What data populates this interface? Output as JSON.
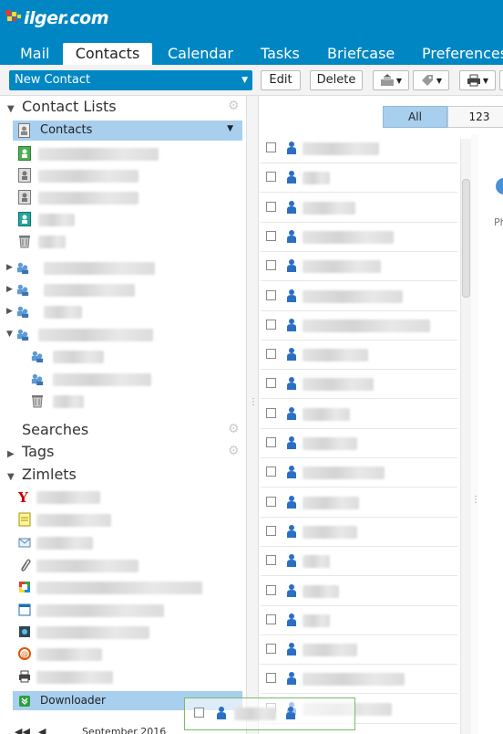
{
  "brand": {
    "logo_text": "ilger.com"
  },
  "app_tabs": [
    {
      "label": "Mail"
    },
    {
      "label": "Contacts"
    },
    {
      "label": "Calendar"
    },
    {
      "label": "Tasks"
    },
    {
      "label": "Briefcase"
    },
    {
      "label": "Preferences"
    }
  ],
  "toolbar": {
    "new_contact_label": "New Contact",
    "edit_label": "Edit",
    "delete_label": "Delete"
  },
  "sidebar": {
    "contact_lists_label": "Contact Lists",
    "selected_list_label": "Contacts",
    "searches_label": "Searches",
    "tags_label": "Tags",
    "zimlets_label": "Zimlets",
    "selected_zimlet_label": "Downloader"
  },
  "list_filter": {
    "all_label": "All",
    "numeric_label": "123"
  },
  "mini_calendar": {
    "month_label": "September 2016"
  },
  "reading_pane": {
    "partial_text": "Ph"
  },
  "colors": {
    "brand_blue": "#0087c3",
    "selection_blue": "#a8cfee"
  },
  "icons": [
    "contact-book-icon",
    "contact-group-icon",
    "trash-icon",
    "gear-icon",
    "person-icon",
    "yahoo-icon",
    "note-icon",
    "email-icon",
    "paperclip-icon",
    "print-icon",
    "downloader-icon"
  ]
}
